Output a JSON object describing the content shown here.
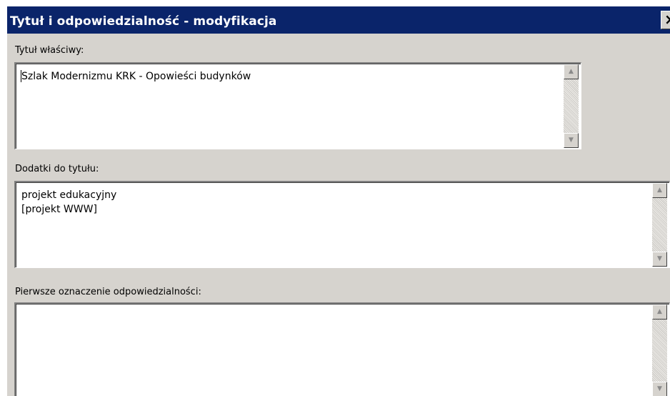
{
  "window": {
    "title": "Tytuł i odpowiedzialność - modyfikacja",
    "close_label": "×"
  },
  "fields": [
    {
      "label": "Tytuł właściwy:",
      "value": "Szlak Modernizmu KRK - Opowieści budynków"
    },
    {
      "label": "Dodatki do tytułu:",
      "value": "projekt edukacyjny\n[projekt WWW]"
    },
    {
      "label": "Pierwsze oznaczenie odpowiedzialności:",
      "value": ""
    }
  ],
  "icons": {
    "scroll_up": "▲",
    "scroll_down": "▼"
  }
}
